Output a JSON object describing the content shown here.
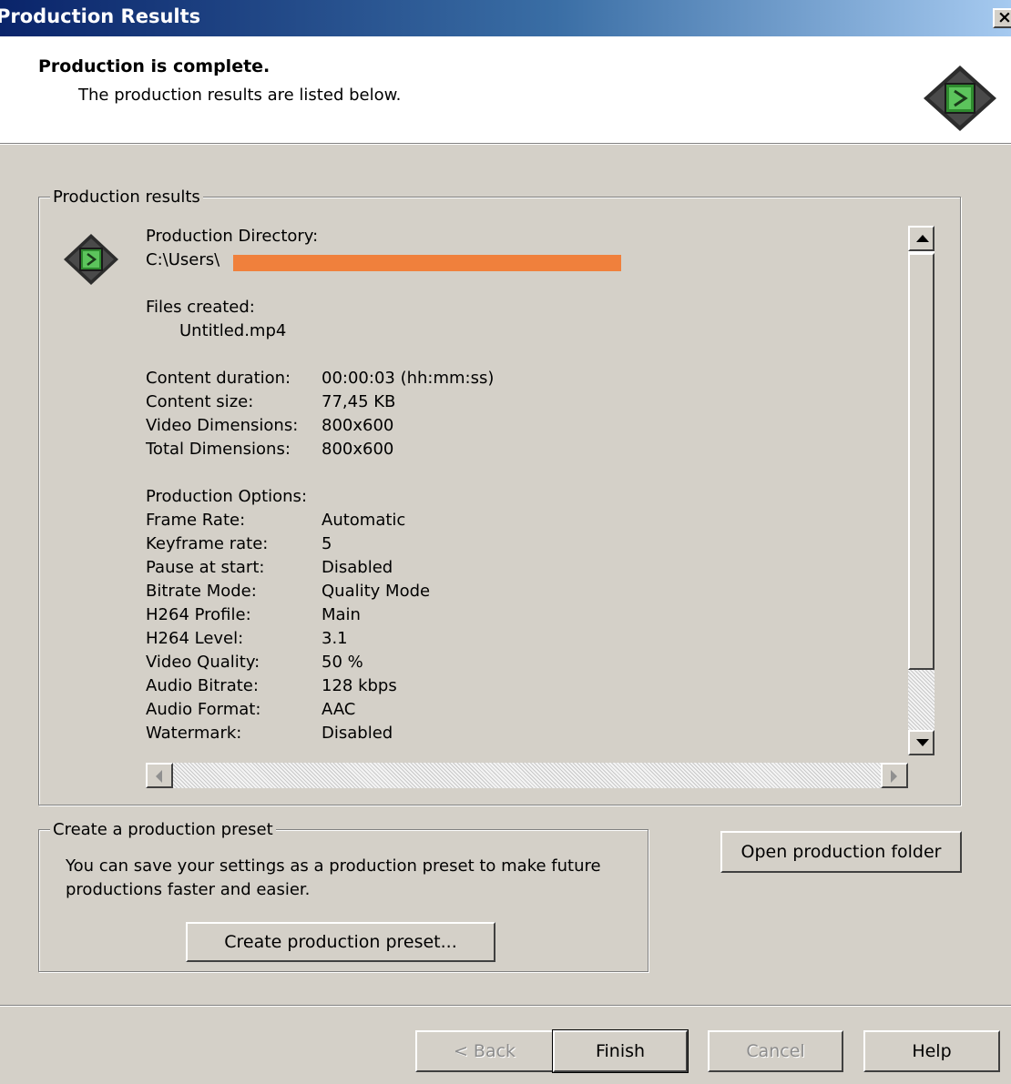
{
  "window": {
    "title": "Production Results",
    "close_glyph": "×"
  },
  "header": {
    "title": "Production is complete.",
    "subtitle": "The production results are listed below.",
    "icon": "camtasia-film-icon"
  },
  "results_group": {
    "legend": "Production results",
    "directory_label": "Production Directory:",
    "directory_value": "C:\\Users\\",
    "files_label": "Files created:",
    "files": [
      "Untitled.mp4"
    ],
    "summary": [
      {
        "label": "Content duration:",
        "value": "00:00:03 (hh:mm:ss)"
      },
      {
        "label": "Content size:",
        "value": "77,45 KB"
      },
      {
        "label": "Video Dimensions:",
        "value": "800x600"
      },
      {
        "label": "Total Dimensions:",
        "value": "800x600"
      }
    ],
    "options_label": "Production Options:",
    "options": [
      {
        "label": "Frame Rate:",
        "value": "Automatic"
      },
      {
        "label": "Keyframe rate:",
        "value": "5"
      },
      {
        "label": "Pause at start:",
        "value": "Disabled"
      },
      {
        "label": "Bitrate Mode:",
        "value": "Quality Mode"
      },
      {
        "label": "H264 Profile:",
        "value": "Main"
      },
      {
        "label": "H264 Level:",
        "value": "3.1"
      },
      {
        "label": "Video Quality:",
        "value": "50 %"
      },
      {
        "label": "Audio Bitrate:",
        "value": "128 kbps"
      },
      {
        "label": "Audio Format:",
        "value": "AAC"
      },
      {
        "label": "Watermark:",
        "value": "Disabled"
      }
    ],
    "redaction_color": "#f0803c"
  },
  "preset_group": {
    "legend": "Create a production preset",
    "text": "You can save your settings as a production preset to make future productions faster and easier.",
    "button": "Create production preset..."
  },
  "open_folder_button": "Open production folder",
  "footer": {
    "back": "< Back",
    "finish": "Finish",
    "cancel": "Cancel",
    "help": "Help"
  }
}
